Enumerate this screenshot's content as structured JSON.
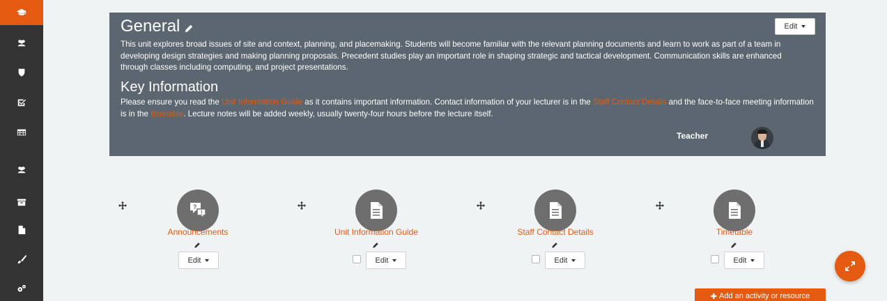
{
  "colors": {
    "accent": "#e55a11",
    "sidebar": "#333333",
    "header_bg": "#5b6670"
  },
  "sidebar": {
    "items": [
      {
        "icon": "graduation-cap-icon",
        "active": true
      },
      {
        "icon": "users-icon"
      },
      {
        "icon": "shield-icon"
      },
      {
        "icon": "check-square-icon"
      },
      {
        "icon": "table-icon"
      },
      {
        "icon": "users-icon"
      },
      {
        "icon": "archive-icon"
      },
      {
        "icon": "file-icon"
      },
      {
        "icon": "paint-brush-icon"
      },
      {
        "icon": "cogs-icon"
      }
    ]
  },
  "section": {
    "title": "General",
    "edit_label": "Edit",
    "summary": "This unit explores broad issues of site and context, planning, and placemaking. Students will become familiar with the relevant planning documents and learn to work as part of a team in developing design strategies and making planning proposals. Precedent studies play an important role in shaping strategic and tactical development. Communication skills are enhanced through classes including computing, and project presentations.",
    "key_heading": "Key Information",
    "key_text_1": "Please ensure you read the ",
    "key_link_1": "Unit Information Guide",
    "key_text_2": " as it contains important information. Contact information of your lecturer is in the ",
    "key_link_2": "Staff Contact Details",
    "key_text_3": " and the face-to-face meeting information is in the ",
    "key_link_3": "timetable",
    "key_text_4": ".   Lecture notes will be added weekly, usually twenty-four hours before the lecture itself.",
    "teacher_label": "Teacher"
  },
  "activities": [
    {
      "name": "Announcements",
      "icon": "forum-icon",
      "edit_label": "Edit",
      "has_checkbox": false
    },
    {
      "name": "Unit Information Guide",
      "icon": "file-icon",
      "edit_label": "Edit",
      "has_checkbox": true
    },
    {
      "name": "Staff Contact Details",
      "icon": "file-icon",
      "edit_label": "Edit",
      "has_checkbox": true
    },
    {
      "name": "Timetable",
      "icon": "file-icon",
      "edit_label": "Edit",
      "has_checkbox": true
    }
  ],
  "add_activity_label": "Add an activity or resource"
}
